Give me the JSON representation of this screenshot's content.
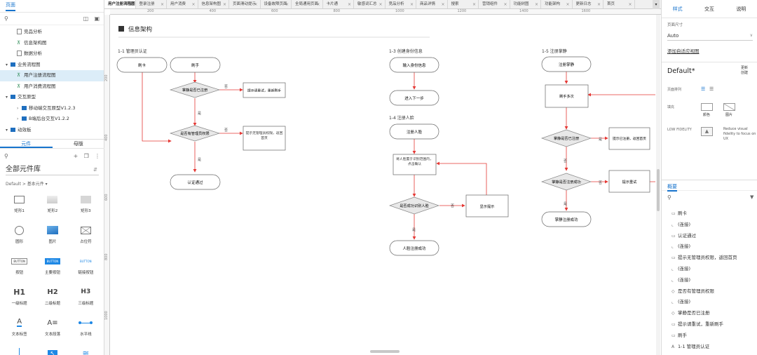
{
  "left_panel": {
    "pages_tab": "页面",
    "pages": [
      {
        "label": "竞品分析",
        "level": 1,
        "type": "page",
        "selected": false
      },
      {
        "label": "信息架构图",
        "level": 1,
        "type": "flow",
        "selected": false
      },
      {
        "label": "数据分析",
        "level": 1,
        "type": "page",
        "selected": false
      },
      {
        "label": "业务流程图",
        "level": 0,
        "type": "folder",
        "selected": false
      },
      {
        "label": "用户注册流程图",
        "level": 1,
        "type": "flow",
        "selected": true
      },
      {
        "label": "用户消费流程图",
        "level": 1,
        "type": "flow",
        "selected": false
      },
      {
        "label": "交互原型",
        "level": 0,
        "type": "folder",
        "selected": false
      },
      {
        "label": "移动端交互原型V1.2.3",
        "level": 1,
        "type": "folder",
        "selected": false
      },
      {
        "label": "B端后台交互V1.2.2",
        "level": 1,
        "type": "folder",
        "selected": false
      },
      {
        "label": "动效板",
        "level": 0,
        "type": "folder",
        "selected": false
      }
    ],
    "components_tab": "元件",
    "masters_tab": "母版",
    "library": "全部元件库",
    "library_sub": "Default > 基本元件 ▾",
    "widgets": [
      {
        "label": "矩形1",
        "icon": "rect-icon"
      },
      {
        "label": "矩形2",
        "icon": "rect-gray-icon"
      },
      {
        "label": "矩形3",
        "icon": "rect-dark-icon"
      },
      {
        "label": "圆形",
        "icon": "circle-icon"
      },
      {
        "label": "图片",
        "icon": "image-icon"
      },
      {
        "label": "占位符",
        "icon": "placeholder-icon"
      },
      {
        "label": "按钮",
        "icon": "button-icon",
        "text": "BUTTON"
      },
      {
        "label": "主要按钮",
        "icon": "primary-button-icon",
        "text": "BUTTON"
      },
      {
        "label": "链接按钮",
        "icon": "link-button-icon",
        "text": "BUTTON"
      },
      {
        "label": "一级标题",
        "icon": "h1-icon",
        "text": "H1"
      },
      {
        "label": "二级标题",
        "icon": "h2-icon",
        "text": "H2"
      },
      {
        "label": "三级标题",
        "icon": "h3-icon",
        "text": "H3"
      },
      {
        "label": "文本标签",
        "icon": "text-label-icon"
      },
      {
        "label": "文本段落",
        "icon": "paragraph-icon"
      },
      {
        "label": "水平线",
        "icon": "hline-icon"
      },
      {
        "label": "",
        "icon": "vline-icon"
      },
      {
        "label": "",
        "icon": "hotspot-icon"
      },
      {
        "label": "",
        "icon": "layers-icon"
      }
    ]
  },
  "tabs": [
    {
      "label": "用户注册流程图",
      "active": true
    },
    {
      "label": "登录注册",
      "active": false
    },
    {
      "label": "用户消费",
      "active": false
    },
    {
      "label": "信息架构图",
      "active": false
    },
    {
      "label": "页面滑动提示",
      "active": false
    },
    {
      "label": "设备故障页面",
      "active": false
    },
    {
      "label": "全局通用页面",
      "active": false
    },
    {
      "label": "卡片通",
      "active": false
    },
    {
      "label": "敏感词汇总",
      "active": false
    },
    {
      "label": "竞品分析",
      "active": false
    },
    {
      "label": "商品详情",
      "active": false
    },
    {
      "label": "搜索",
      "active": false
    },
    {
      "label": "营销组件",
      "active": false
    },
    {
      "label": "功能树图",
      "active": false
    },
    {
      "label": "功能架构",
      "active": false
    },
    {
      "label": "更新日志",
      "active": false
    },
    {
      "label": "首页",
      "active": false
    }
  ],
  "ruler": {
    "h": [
      "200",
      "400",
      "600",
      "800",
      "1000",
      "1200",
      "1400",
      "1600"
    ],
    "v": [
      "200",
      "400",
      "600",
      "800",
      "1000"
    ]
  },
  "canvas": {
    "heading": "信息架构",
    "sections": {
      "s11": "1-1 管理员认证",
      "s13": "1-3 创建身份信息",
      "s14": "1-4 注册人脸",
      "s15": "1-5 注册掌静"
    },
    "nodes": {
      "a_start": "刷卡",
      "a_palm": "刷手",
      "a_d1": "掌静是否已注册",
      "a_err1": "提示请重试，重新刷手",
      "a_d2": "是否有管理员权限",
      "a_err2": "提示无管理员权限，返回首页",
      "a_end": "认证通过",
      "b_input": "输入身份信息",
      "b_next": "进入下一步",
      "c_start": "注册人脸",
      "c_frame": "将人脸置于识别范围内，点击确认",
      "c_d": "是否成功识别人脸",
      "c_tip": "显示提示",
      "c_end": "人脸注册成功",
      "d_start": "注册掌静",
      "d_multi": "刷手多次",
      "d_d1": "掌静是否已注册",
      "d_tip1": "提示已注册，返回首页",
      "d_d2": "掌静是否注册成功",
      "d_tip2": "提示重试",
      "d_end": "掌静注册成功"
    },
    "edge_labels": {
      "yes": "是",
      "no": "否"
    }
  },
  "right_panel": {
    "tabs": [
      "样式",
      "交互",
      "说明"
    ],
    "page_size_label": "页面尺寸",
    "page_size_value": "Auto",
    "add_adaptive": "添加自适应视图",
    "style_name": "Default*",
    "update_label": "更新\n创建",
    "align_label": "页面排列",
    "fill_label": "填充",
    "fill_color": "颜色",
    "fill_image": "图片",
    "low_fidelity": "LOW FIDELITY",
    "low_fidelity_desc": "Reduce visual fidelity to focus on UX",
    "outline_tab": "概要",
    "outline": [
      {
        "label": "刷卡",
        "icon": "rect-outline-icon"
      },
      {
        "label": "(连接)",
        "icon": "connector-icon"
      },
      {
        "label": "认证通过",
        "icon": "rect-outline-icon"
      },
      {
        "label": "(连接)",
        "icon": "connector-icon"
      },
      {
        "label": "提示无管理员权限，返回首页",
        "icon": "rect-outline-icon"
      },
      {
        "label": "(连接)",
        "icon": "connector-icon"
      },
      {
        "label": "(连接)",
        "icon": "connector-icon"
      },
      {
        "label": "是否有管理员权限",
        "icon": "diamond-outline-icon"
      },
      {
        "label": "(连接)",
        "icon": "connector-icon"
      },
      {
        "label": "掌静是否已注册",
        "icon": "diamond-outline-icon"
      },
      {
        "label": "提示请重试，重新刷手",
        "icon": "rect-outline-icon"
      },
      {
        "label": "刷手",
        "icon": "rect-outline-icon"
      },
      {
        "label": "1-1 管理员认证",
        "icon": "text-outline-icon"
      }
    ]
  },
  "colors": {
    "accent": "#1874cd",
    "arrow": "#e53935",
    "node_border": "#666666",
    "selected_bg": "#dcedf8"
  }
}
